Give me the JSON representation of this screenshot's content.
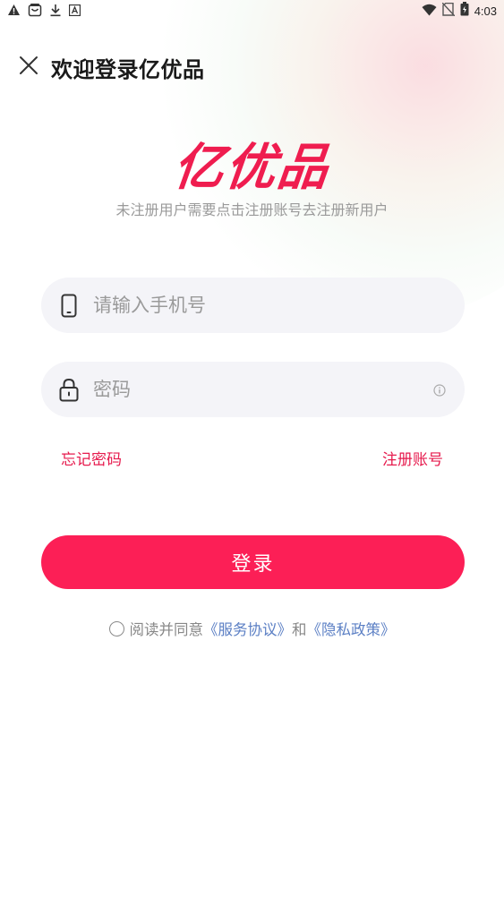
{
  "status_bar": {
    "time": "4:03",
    "left_icons": [
      "warning-icon",
      "bag-icon",
      "download-icon",
      "font-icon"
    ],
    "right_icons": [
      "wifi-icon",
      "no-sim-icon",
      "battery-icon"
    ]
  },
  "header": {
    "title": "欢迎登录亿优品",
    "close_icon": "close-icon"
  },
  "brand": {
    "name": "亿优品",
    "tagline": "未注册用户需要点击注册账号去注册新用户",
    "color": "#ef1d4f"
  },
  "form": {
    "phone": {
      "placeholder": "请输入手机号",
      "value": "",
      "icon": "phone-icon"
    },
    "password": {
      "placeholder": "密码",
      "value": "",
      "icon": "lock-icon",
      "trailing_icon": "info-icon"
    },
    "forgot_label": "忘记密码",
    "register_label": "注册账号",
    "login_label": "登录",
    "accent_color": "#fc1f56"
  },
  "agreement": {
    "prefix": "阅读并同意",
    "service_link": "《服务协议》",
    "and": "和",
    "privacy_link": "《隐私政策》",
    "checked": false
  }
}
